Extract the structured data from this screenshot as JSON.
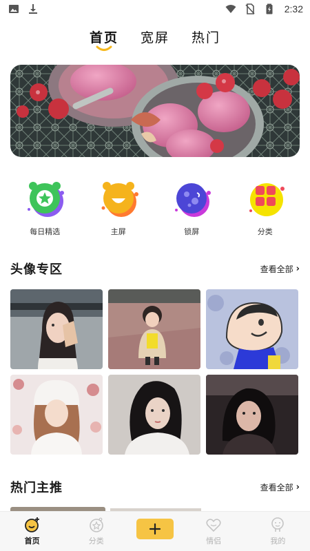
{
  "status_bar": {
    "time": "2:32",
    "left_icons": [
      "image-icon",
      "download-icon"
    ],
    "right_icons": [
      "wifi-icon",
      "no-sim-icon",
      "battery-charging-icon"
    ]
  },
  "top_tabs": [
    {
      "label": "首页",
      "active": true
    },
    {
      "label": "宽屏",
      "active": false
    },
    {
      "label": "热门",
      "active": false
    }
  ],
  "banner": {
    "image": "ice-cream-with-raspberries-and-figs"
  },
  "quick_categories": [
    {
      "label": "每日精选",
      "icon": "star-badge-icon",
      "color": "#3ec45a"
    },
    {
      "label": "主屏",
      "icon": "smile-cat-icon",
      "color": "#f5b31c"
    },
    {
      "label": "锁屏",
      "icon": "planet-face-icon",
      "color": "#4c46d6"
    },
    {
      "label": "分类",
      "icon": "grid-tiles-icon",
      "color": "#ef4a5a"
    }
  ],
  "avatar_section": {
    "title": "头像专区",
    "see_all": "查看全部",
    "items": [
      "girl-with-hand-near-face",
      "toddler-in-fur-coat",
      "cartoon-boy-crayon-shinchan",
      "girl-in-white-knit-hat",
      "girl-in-white-sweater",
      "girl-in-car"
    ]
  },
  "hot_section": {
    "title": "热门主推",
    "see_all": "查看全部"
  },
  "bottom_nav": {
    "items": [
      {
        "label": "首页",
        "icon": "home-smile-icon",
        "active": true
      },
      {
        "label": "分类",
        "icon": "category-icon",
        "active": false
      },
      {
        "label": "情侣",
        "icon": "couple-heart-icon",
        "active": false
      },
      {
        "label": "我的",
        "icon": "profile-icon",
        "active": false
      }
    ],
    "add_label": "+"
  },
  "colors": {
    "accent": "#f6c444",
    "text_primary": "#1a1a1a",
    "nav_inactive": "#b3b3b3"
  }
}
